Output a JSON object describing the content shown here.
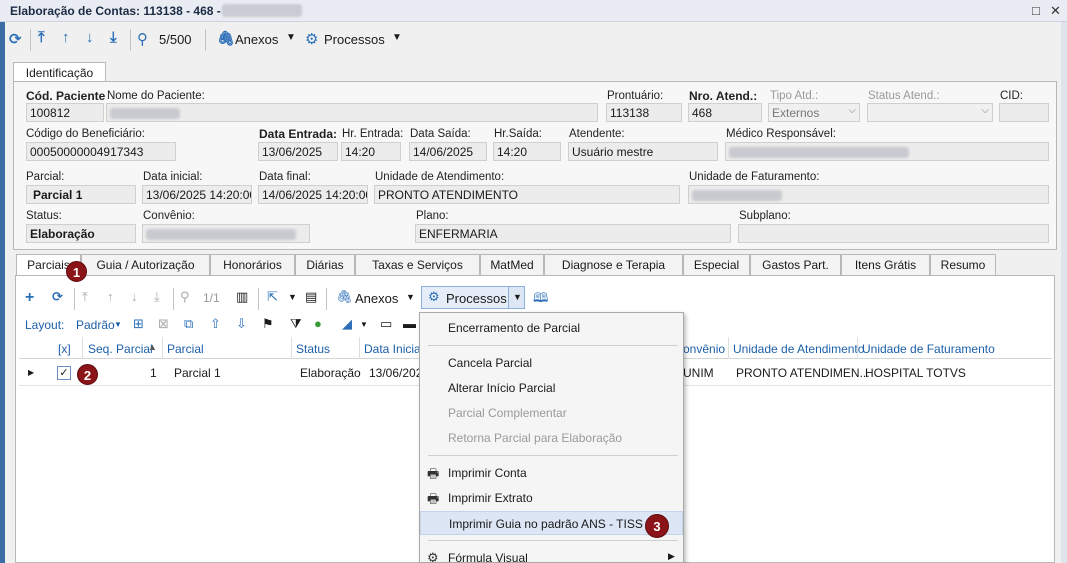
{
  "window": {
    "title": "Elaboração de Contas: 113138 - 468 -",
    "controls": {
      "restore": "□",
      "close": "✕"
    }
  },
  "toolbar": {
    "refresh_icon": "refresh-icon",
    "first_icon": "first-record-icon",
    "prev_icon": "up-arrow-icon",
    "next_icon": "down-arrow-icon",
    "last_icon": "last-record-icon",
    "record_counter": "5/500",
    "anexos_label": "Anexos",
    "processos_label": "Processos"
  },
  "form_tab": "Identificação",
  "fields": {
    "cod_paciente": {
      "label": "Cód. Paciente",
      "value": "100812"
    },
    "nome_paciente": {
      "label": "Nome do Paciente:"
    },
    "prontuario": {
      "label": "Prontuário:",
      "value": "113138"
    },
    "nro_atend": {
      "label": "Nro. Atend.:",
      "value": "468"
    },
    "tipo_atd": {
      "label": "Tipo Atd.:",
      "value": "Externos"
    },
    "status_atend": {
      "label": "Status Atend.:",
      "value": ""
    },
    "cid": {
      "label": "CID:",
      "value": ""
    },
    "cod_beneficiario": {
      "label": "Código do Beneficiário:",
      "value": "00050000004917343"
    },
    "data_entrada": {
      "label": "Data Entrada:",
      "value": "13/06/2025"
    },
    "hr_entrada": {
      "label": "Hr. Entrada:",
      "value": "14:20"
    },
    "data_saida": {
      "label": "Data Saída:",
      "value": "14/06/2025"
    },
    "hr_saida": {
      "label": "Hr.Saída:",
      "value": "14:20"
    },
    "atendente": {
      "label": "Atendente:",
      "value": "Usuário mestre"
    },
    "medico": {
      "label": "Médico Responsável:"
    },
    "parcial": {
      "label": "Parcial:",
      "value": "Parcial 1"
    },
    "data_inicial": {
      "label": "Data inicial:",
      "value": "13/06/2025 14:20:00"
    },
    "data_final": {
      "label": "Data final:",
      "value": "14/06/2025 14:20:00"
    },
    "unidade_atendimento": {
      "label": "Unidade de Atendimento:",
      "value": "PRONTO ATENDIMENTO"
    },
    "unidade_faturamento": {
      "label": "Unidade de Faturamento:"
    },
    "status": {
      "label": "Status:",
      "value": "Elaboração"
    },
    "convenio": {
      "label": "Convênio:"
    },
    "plano": {
      "label": "Plano:",
      "value": "ENFERMARIA"
    },
    "subplano": {
      "label": "Subplano:",
      "value": ""
    }
  },
  "tabs": [
    {
      "label": "Parciais"
    },
    {
      "label": "Guia / Autorização"
    },
    {
      "label": "Honorários"
    },
    {
      "label": "Diárias"
    },
    {
      "label": "Taxas e Serviços"
    },
    {
      "label": "MatMed"
    },
    {
      "label": "Diagnose e Terapia"
    },
    {
      "label": "Especial"
    },
    {
      "label": "Gastos Part."
    },
    {
      "label": "Itens Grátis"
    },
    {
      "label": "Resumo"
    }
  ],
  "inner_toolbar": {
    "page_counter": "1/1",
    "anexos_label": "Anexos",
    "processos_label": "Processos",
    "layout_label": "Layout:",
    "layout_value": "Padrão"
  },
  "grid": {
    "columns": [
      "[x]",
      "Seq. Parcial",
      "Parcial",
      "Status",
      "Data Inicial",
      "onvênio",
      "Unidade de Atendimento",
      "Unidade de Faturamento"
    ],
    "rows": [
      {
        "seq": "1",
        "parcial": "Parcial 1",
        "status": "Elaboração",
        "data_inicial": "13/06/202",
        "convenio": "UNIM",
        "unidade_atendimento": "PRONTO ATENDIMEN...",
        "unidade_faturamento": "HOSPITAL TOTVS"
      }
    ]
  },
  "menu": {
    "items": [
      {
        "label": "Encerramento de Parcial",
        "enabled": true
      },
      {
        "label": "Cancela Parcial",
        "enabled": true
      },
      {
        "label": "Alterar Início Parcial",
        "enabled": true
      },
      {
        "label": "Parcial Complementar",
        "enabled": false
      },
      {
        "label": "Retorna Parcial para Elaboração",
        "enabled": false
      },
      {
        "label": "Imprimir Conta",
        "enabled": true
      },
      {
        "label": "Imprimir Extrato",
        "enabled": true
      },
      {
        "label": "Imprimir Guia no padrão ANS - TISS",
        "enabled": true
      },
      {
        "label": "Fórmula Visual",
        "enabled": true
      }
    ]
  },
  "annotations": [
    "1",
    "2",
    "3"
  ],
  "colors": {
    "accent": "#2c6fb8",
    "badge": "#8b1418",
    "highlight": "#dce6f4"
  }
}
